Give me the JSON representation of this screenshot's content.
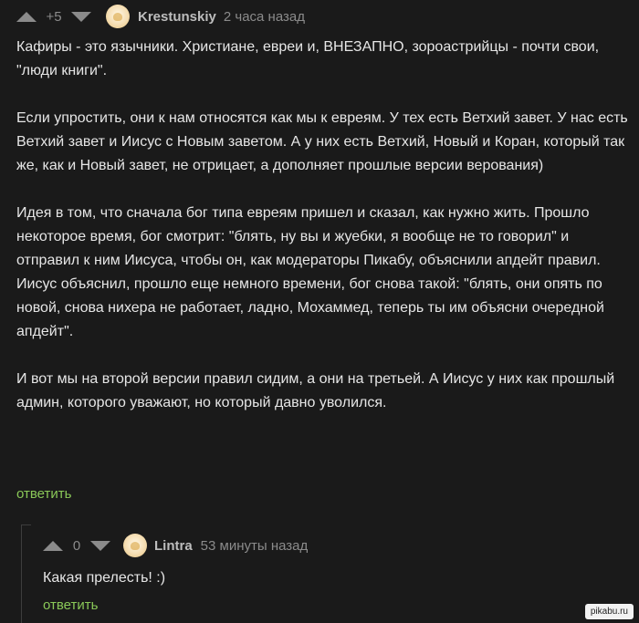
{
  "comments": [
    {
      "rating": "+5",
      "username": "Krestunskiy",
      "timestamp": "2 часа назад",
      "paragraphs": [
        "Кафиры - это язычники. Христиане, евреи и, ВНЕЗАПНО, зороастрийцы - почти свои, \"люди книги\".",
        "Если упростить, они к нам относятся как мы к евреям. У тех есть Ветхий завет. У нас есть Ветхий завет и Иисус с Новым заветом. А у них есть Ветхий, Новый и Коран, который так же, как и Новый завет, не отрицает, а дополняет прошлые версии верования)",
        "Идея в том, что сначала бог типа евреям пришел и сказал, как нужно жить. Прошло некоторое время, бог смотрит: \"блять, ну вы и жуебки, я вообще не то говорил\" и отправил к ним Иисуса, чтобы он, как модераторы Пикабу, объяснили апдейт правил. Иисус объяснил, прошло еще немного времени, бог снова такой: \"блять, они опять по новой, снова нихера не работает, ладно, Мохаммед, теперь ты им объясни очередной апдейт\".",
        "И вот мы на второй версии правил сидим, а они на третьей. А Иисус у них как прошлый админ, которого уважают, но который давно уволился."
      ],
      "reply_label": "ответить"
    },
    {
      "rating": "0",
      "username": "Lintra",
      "timestamp": "53 минуты назад",
      "paragraphs": [
        "Какая прелесть! :)"
      ],
      "reply_label": "ответить"
    }
  ],
  "watermark": "pikabu.ru",
  "colors": {
    "background": "#1a1a1a",
    "text": "#e6e6e6",
    "muted": "#8b8b8b",
    "reply": "#8ac858"
  },
  "icons": [
    "vote-up-arrow",
    "vote-down-arrow",
    "user-avatar"
  ]
}
